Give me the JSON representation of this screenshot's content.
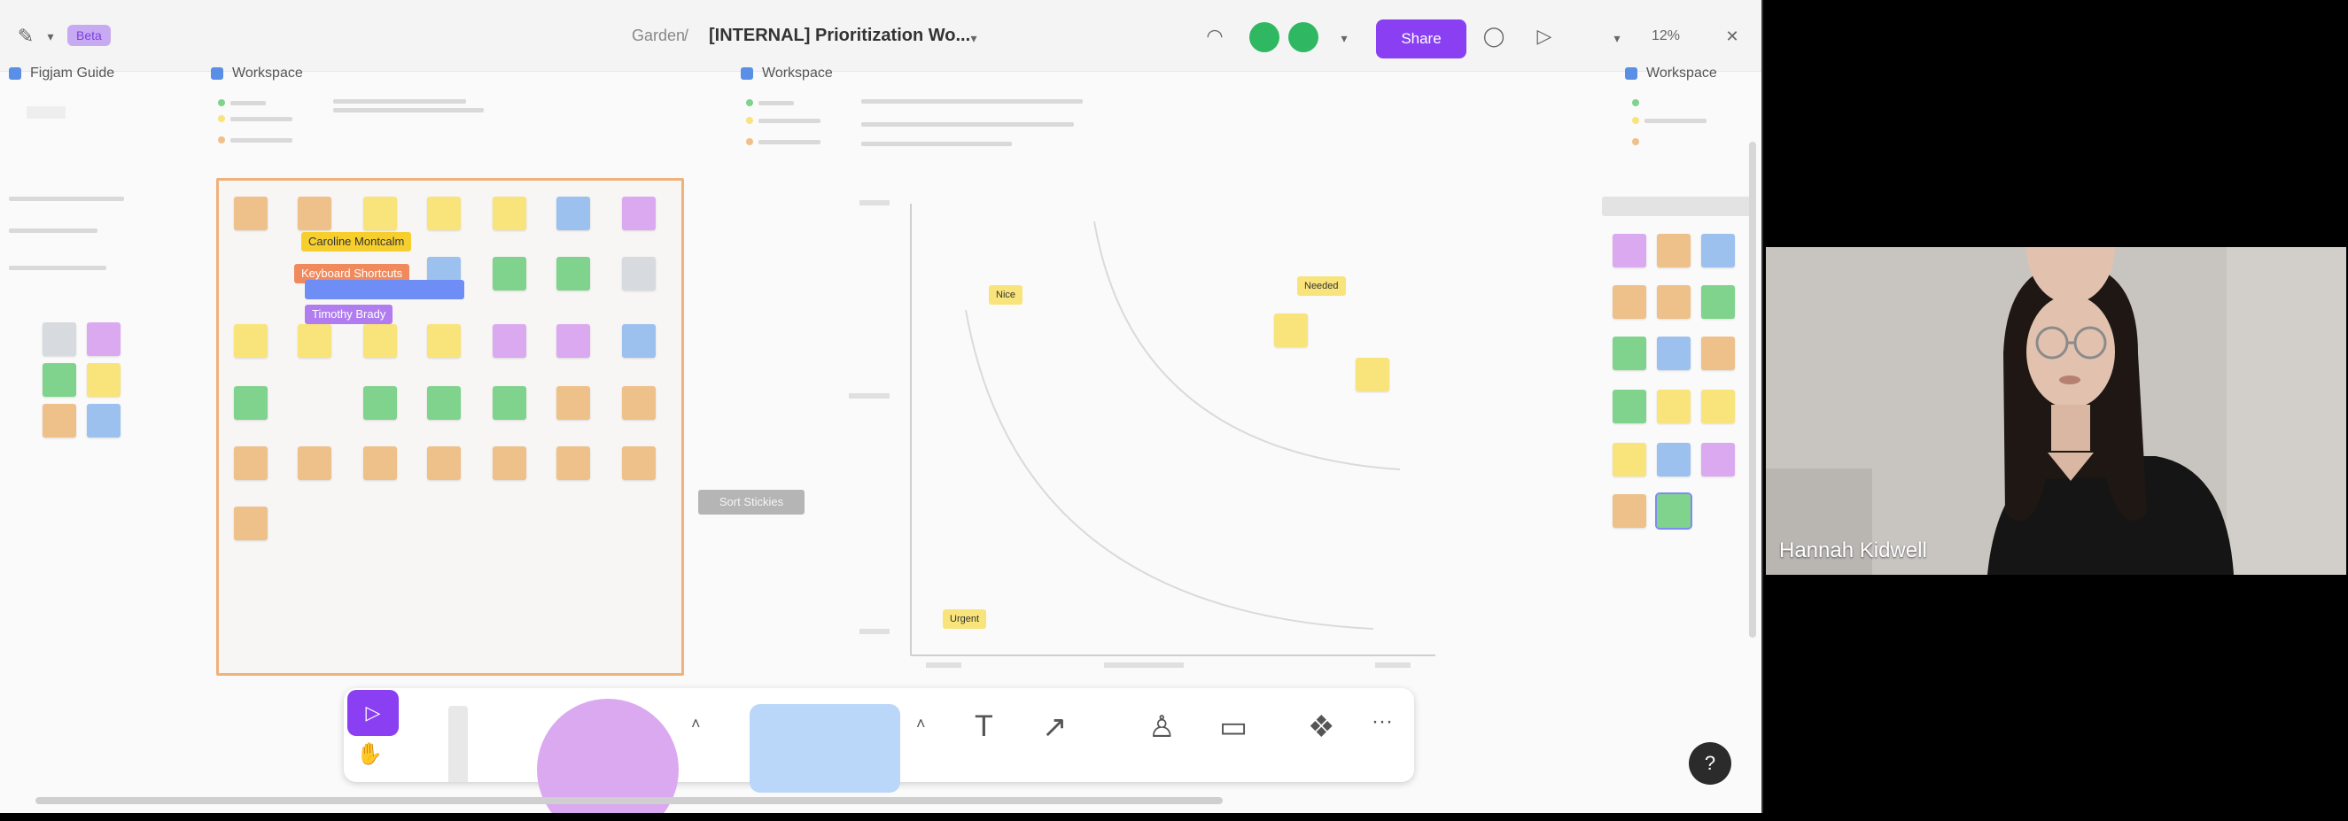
{
  "topbar": {
    "beta_badge": "Beta",
    "breadcrumb": "Garden",
    "separator": "/",
    "file_title": "[INTERNAL] Prioritization Wo...",
    "share_label": "Share",
    "zoom_level": "12%"
  },
  "sections": [
    {
      "title": "Figjam Guide"
    },
    {
      "title": "Workspace"
    },
    {
      "title": "Workspace"
    },
    {
      "title": "Workspace"
    }
  ],
  "canvas": {
    "tags": [
      "Caroline Montcalm",
      "Keyboard Shortcuts",
      "Timothy Brady"
    ],
    "side_label": "Sort Stickies",
    "chart_labels": [
      "Nice",
      "Needed",
      "Urgent"
    ]
  },
  "video": {
    "participant_name": "Hannah Kidwell"
  },
  "help_label": "?",
  "colors": {
    "accent": "#8a3ff2",
    "frame": "#f0b27a",
    "avatar": "#2fb861"
  }
}
